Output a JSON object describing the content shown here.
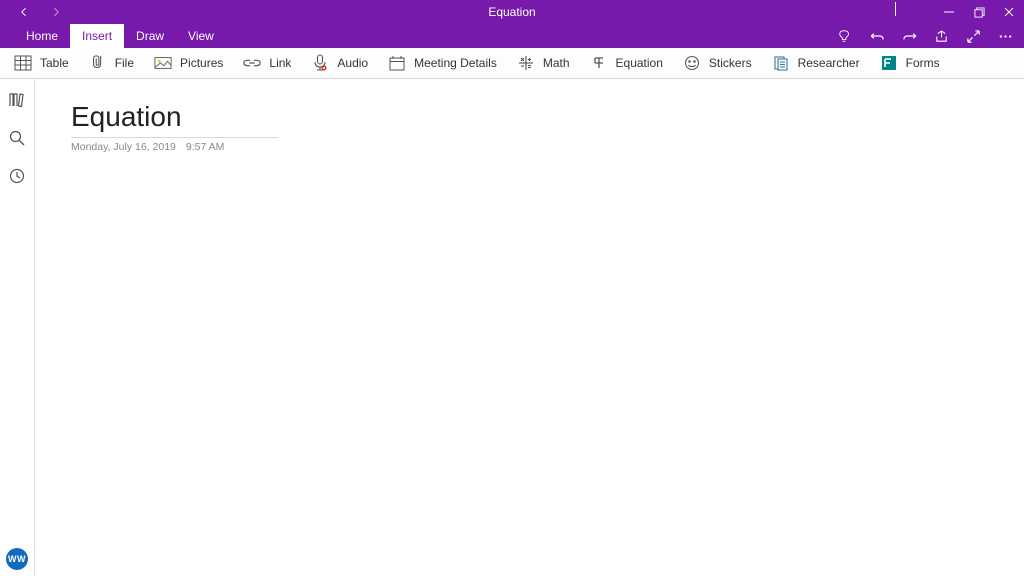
{
  "window": {
    "title": "Equation"
  },
  "tabs": {
    "home": "Home",
    "insert": "Insert",
    "draw": "Draw",
    "view": "View",
    "active": "insert"
  },
  "ribbon": {
    "table": "Table",
    "file": "File",
    "pictures": "Pictures",
    "link": "Link",
    "audio": "Audio",
    "meeting": "Meeting Details",
    "math": "Math",
    "equation": "Equation",
    "stickers": "Stickers",
    "researcher": "Researcher",
    "forms": "Forms"
  },
  "page": {
    "title": "Equation",
    "date": "Monday, July 16, 2019",
    "time": "9:57 AM"
  },
  "avatar": "WW"
}
